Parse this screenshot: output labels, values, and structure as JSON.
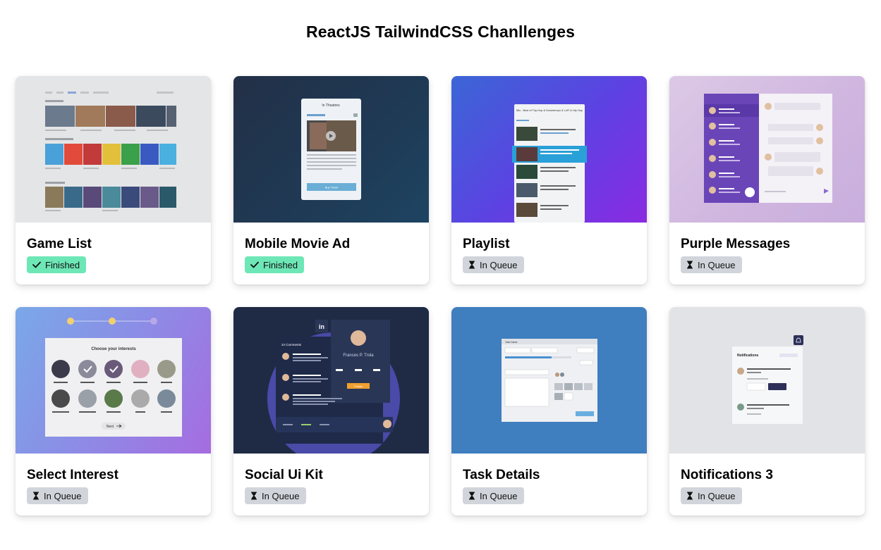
{
  "header": {
    "title": "ReactJS TailwindCSS Chanllenges"
  },
  "status_labels": {
    "finished": "Finished",
    "queue": "In Queue"
  },
  "cards": [
    {
      "title": "Game List",
      "status": "Finished",
      "thumbnail": "game-list-preview"
    },
    {
      "title": "Mobile Movie Ad",
      "status": "Finished",
      "thumbnail": "mobile-movie-ad-preview"
    },
    {
      "title": "Playlist",
      "status": "In Queue",
      "thumbnail": "playlist-preview"
    },
    {
      "title": "Purple Messages",
      "status": "In Queue",
      "thumbnail": "purple-messages-preview"
    },
    {
      "title": "Select Interest",
      "status": "In Queue",
      "thumbnail": "select-interest-preview"
    },
    {
      "title": "Social Ui Kit",
      "status": "In Queue",
      "thumbnail": "social-ui-kit-preview"
    },
    {
      "title": "Task Details",
      "status": "In Queue",
      "thumbnail": "task-details-preview"
    },
    {
      "title": "Notifications 3",
      "status": "In Queue",
      "thumbnail": "notifications-3-preview"
    }
  ],
  "previews": {
    "movie": {
      "header": "In Theatres",
      "button": "Buy Ticket"
    },
    "playlist": {
      "title": "Mix - Best of Trip-Hop & Downtempo & LoFi & Hip Hop"
    },
    "interest": {
      "heading": "Choose your interests",
      "next": "Next"
    },
    "social": {
      "name": "Frances P. Trola",
      "comments": "24 Comments",
      "follow": "Follow"
    },
    "task": {
      "title": "Task Name"
    },
    "notif": {
      "title": "Notifications"
    }
  },
  "colors": {
    "finished_badge": "#6ee7b7",
    "queue_badge": "#d1d5db",
    "accent_purple": "#7c3aed",
    "accent_blue": "#3f7ebf"
  }
}
